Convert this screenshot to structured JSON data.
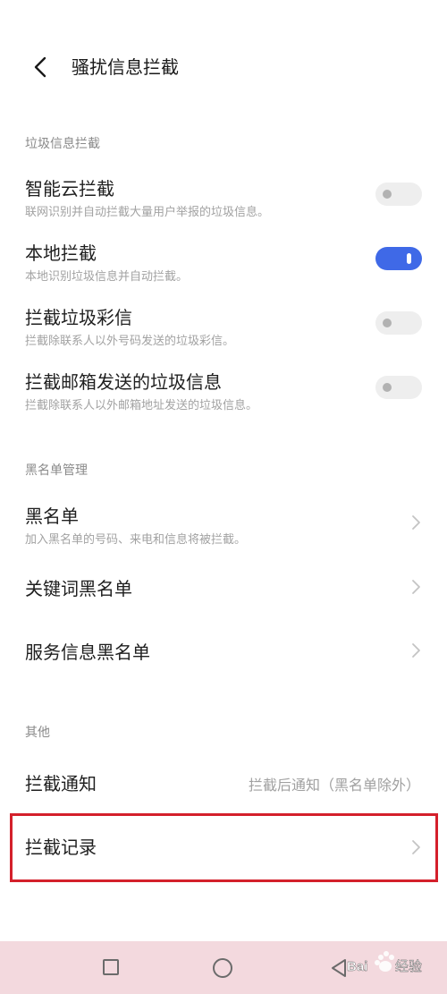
{
  "header": {
    "title": "骚扰信息拦截"
  },
  "sections": {
    "spam": {
      "title": "垃圾信息拦截",
      "items": [
        {
          "title": "智能云拦截",
          "subtitle": "联网识别并自动拦截大量用户举报的垃圾信息。",
          "toggle": false
        },
        {
          "title": "本地拦截",
          "subtitle": "本地识别垃圾信息并自动拦截。",
          "toggle": true
        },
        {
          "title": "拦截垃圾彩信",
          "subtitle": "拦截除联系人以外号码发送的垃圾彩信。",
          "toggle": false
        },
        {
          "title": "拦截邮箱发送的垃圾信息",
          "subtitle": "拦截除联系人以外邮箱地址发送的垃圾信息。",
          "toggle": false
        }
      ]
    },
    "blacklist": {
      "title": "黑名单管理",
      "items": [
        {
          "title": "黑名单",
          "subtitle": "加入黑名单的号码、来电和信息将被拦截。"
        },
        {
          "title": "关键词黑名单"
        },
        {
          "title": "服务信息黑名单"
        }
      ]
    },
    "other": {
      "title": "其他",
      "items": [
        {
          "title": "拦截通知",
          "value": "拦截后通知（黑名单除外）"
        },
        {
          "title": "拦截记录"
        }
      ]
    }
  },
  "colors": {
    "accent": "#3f69e7",
    "highlight_border": "#d4202b",
    "navbar_bg": "#f3d9de"
  },
  "icons": {
    "back": "chevron-left-icon",
    "row_arrow": "chevron-right-icon",
    "nav_recent": "square-icon",
    "nav_home": "circle-icon",
    "nav_back": "triangle-back-icon"
  },
  "watermark": {
    "text": "Baidu经验"
  }
}
